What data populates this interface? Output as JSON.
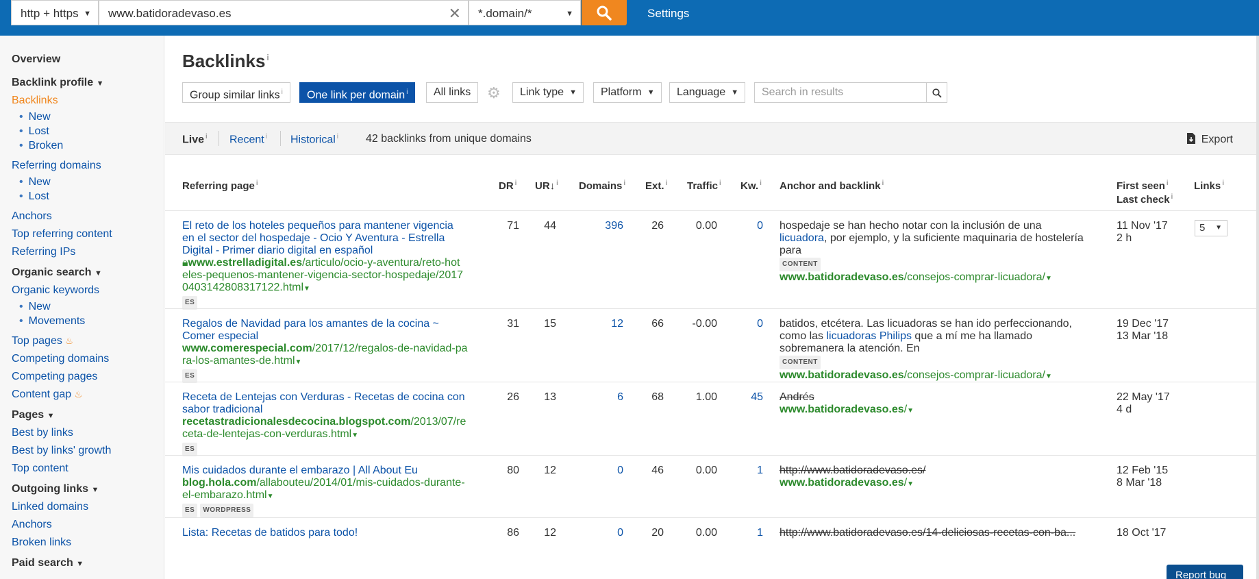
{
  "topbar": {
    "protocol": "http + https",
    "url_value": "www.batidoradevaso.es",
    "mode": "*.domain/*",
    "settings": "Settings"
  },
  "sidebar": {
    "overview": "Overview",
    "backlink_profile": "Backlink profile",
    "backlinks": "Backlinks",
    "bl_new": "New",
    "bl_lost": "Lost",
    "bl_broken": "Broken",
    "referring_domains": "Referring domains",
    "rd_new": "New",
    "rd_lost": "Lost",
    "anchors": "Anchors",
    "top_referring_content": "Top referring content",
    "referring_ips": "Referring IPs",
    "organic_search": "Organic search",
    "organic_keywords": "Organic keywords",
    "ok_new": "New",
    "ok_movements": "Movements",
    "top_pages": "Top pages",
    "competing_domains": "Competing domains",
    "competing_pages": "Competing pages",
    "content_gap": "Content gap",
    "pages": "Pages",
    "best_by_links": "Best by links",
    "best_by_links_growth": "Best by links' growth",
    "top_content": "Top content",
    "outgoing_links": "Outgoing links",
    "linked_domains": "Linked domains",
    "out_anchors": "Anchors",
    "broken_links": "Broken links",
    "paid_search": "Paid search"
  },
  "main": {
    "title": "Backlinks",
    "seg_group": "Group similar links",
    "seg_one": "One link per domain",
    "seg_all": "All links",
    "link_type": "Link type",
    "platform": "Platform",
    "language": "Language",
    "search_placeholder": "Search in results",
    "live": "Live",
    "recent": "Recent",
    "historical": "Historical",
    "summary": "42 backlinks from unique domains",
    "export": "Export"
  },
  "table": {
    "headers": {
      "referring_page": "Referring page",
      "dr": "DR",
      "ur": "UR",
      "domains": "Domains",
      "ext": "Ext.",
      "traffic": "Traffic",
      "kw": "Kw.",
      "anchor": "Anchor and backlink",
      "first_seen": "First seen",
      "last_check": "Last check",
      "links": "Links"
    },
    "rows": [
      {
        "title_l1": "El reto de los hoteles pequeños para mantener vigencia",
        "title_l2": "en el sector del hospedaje - Ocio Y Aventura - Estrella",
        "title_l3": "Digital - Primer diario digital en español",
        "url_domain": "www.estrelladigital.es",
        "url_path1": "/articulo/ocio-y-aventura/reto-hot",
        "url_path2": "eles-pequenos-mantener-vigencia-sector-hospedaje/2017",
        "url_path3": "0403142808317122.html",
        "lang": "ES",
        "dr": "71",
        "ur": "44",
        "domains": "396",
        "ext": "26",
        "traffic": "0.00",
        "kw": "0",
        "anchor_l1": "hospedaje se han hecho notar con la inclusión de una",
        "anchor_link": "licuadora",
        "anchor_l2_rest": ", por ejemplo, y la suficiente maquinaria de hostelería",
        "anchor_l3": "para",
        "anchor_tag": "CONTENT",
        "backlink_domain": "www.batidoradevaso.es",
        "backlink_path": "/consejos-comprar-licuadora/",
        "first_seen": "11 Nov '17",
        "last_check": "2 h",
        "links": "5"
      },
      {
        "title_l1": "Regalos de Navidad para los amantes de la cocina ~",
        "title_l2": "Comer especial",
        "url_domain": "www.comerespecial.com",
        "url_path1": "/2017/12/regalos-de-navidad-pa",
        "url_path2": "ra-los-amantes-de.html",
        "lang": "ES",
        "dr": "31",
        "ur": "15",
        "domains": "12",
        "ext": "66",
        "traffic": "-0.00",
        "kw": "0",
        "anchor_l1": "batidos, etcétera. Las licuadoras se han ido perfeccionando,",
        "anchor_l2_pre": "como las ",
        "anchor_link": "licuadoras Philips",
        "anchor_l2_rest": " que a mí me ha llamado",
        "anchor_l3": "sobremanera la atención. En",
        "anchor_tag": "CONTENT",
        "backlink_domain": "www.batidoradevaso.es",
        "backlink_path": "/consejos-comprar-licuadora/",
        "first_seen": "19 Dec '17",
        "last_check": "13 Mar '18"
      },
      {
        "title_l1": "Receta de Lentejas con Verduras - Recetas de cocina con",
        "title_l2": "sabor tradicional",
        "url_domain": "recetastradicionalesdecocina.blogspot.com",
        "url_path1": "/2013/07/re",
        "url_path2": "ceta-de-lentejas-con-verduras.html",
        "lang": "ES",
        "dr": "26",
        "ur": "13",
        "domains": "6",
        "ext": "68",
        "traffic": "1.00",
        "kw": "45",
        "anchor_struck": "Andrés",
        "backlink_domain": "www.batidoradevaso.es",
        "backlink_path": "/",
        "first_seen": "22 May '17",
        "last_check": "4 d"
      },
      {
        "title_l1": "Mis cuidados durante el embarazo | All About Eu",
        "url_domain": "blog.hola.com",
        "url_path1": "/allabouteu/2014/01/mis-cuidados-durante-",
        "url_path2": "el-embarazo.html",
        "lang": "ES",
        "platform": "WORDPRESS",
        "dr": "80",
        "ur": "12",
        "domains": "0",
        "ext": "46",
        "traffic": "0.00",
        "kw": "1",
        "anchor_struck": "http://www.batidoradevaso.es/",
        "backlink_domain": "www.batidoradevaso.es",
        "backlink_path": "/",
        "first_seen": "12 Feb '15",
        "last_check": "8 Mar '18"
      },
      {
        "title_l1": "Lista: Recetas de batidos para todo!",
        "dr": "86",
        "ur": "12",
        "domains": "0",
        "ext": "20",
        "traffic": "0.00",
        "kw": "1",
        "anchor_struck": "http://www.batidoradevaso.es/14-deliciosas-recetas-con-ba...",
        "first_seen": "18 Oct '17"
      }
    ]
  },
  "report_bug": "Report bug"
}
